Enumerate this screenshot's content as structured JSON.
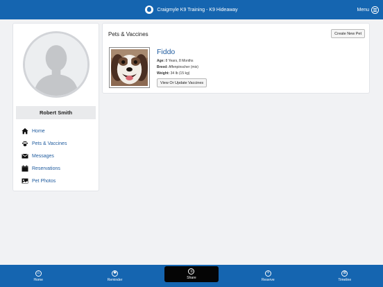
{
  "header": {
    "title": "Craigmyle K9 Training - K9 Hideaway",
    "menu_label": "Menu"
  },
  "profile": {
    "name": "Robert Smith"
  },
  "sidebar": {
    "items": [
      {
        "label": "Home",
        "icon": "home-icon"
      },
      {
        "label": "Pets & Vaccines",
        "icon": "paw-icon"
      },
      {
        "label": "Messages",
        "icon": "envelope-icon"
      },
      {
        "label": "Reservations",
        "icon": "calendar-icon"
      },
      {
        "label": "Pet Photos",
        "icon": "photo-icon"
      }
    ]
  },
  "pets": {
    "section_title": "Pets & Vaccines",
    "create_button": "Create New Pet",
    "pet": {
      "name": "Fiddo",
      "age_label": "Age:",
      "age": "8 Years, 8 Months",
      "breed_label": "Breed:",
      "breed": "Affenpinscher (mix)",
      "weight_label": "Weight:",
      "weight": "34 lb (15 kg)",
      "vaccines_button": "View Or Update Vaccines"
    }
  },
  "bottom_nav": {
    "tabs": [
      {
        "label": "Home",
        "icon": "home-circle-icon"
      },
      {
        "label": "Reminder",
        "icon": "bell-circle-icon"
      },
      {
        "label": "Share",
        "icon": "share-circle-icon",
        "active": true
      },
      {
        "label": "Reserve",
        "icon": "plus-circle-icon"
      },
      {
        "label": "Timeline",
        "icon": "timeline-circle-icon"
      }
    ]
  },
  "colors": {
    "brand_blue": "#1565b0",
    "link_blue": "#1f5b9e",
    "active_tab": "#050505",
    "background": "#f1f2f4"
  }
}
